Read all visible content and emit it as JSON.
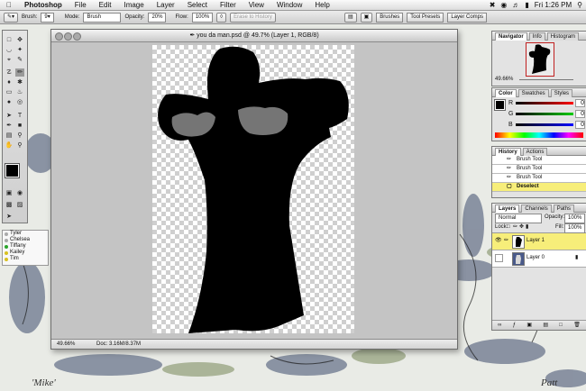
{
  "menubar": {
    "app_name": "Photoshop",
    "items": [
      "File",
      "Edit",
      "Image",
      "Layer",
      "Select",
      "Filter",
      "View",
      "Window",
      "Help"
    ],
    "clock": "Fri 1:26 PM"
  },
  "options_bar": {
    "brush_label": "Brush:",
    "brush_size": "9",
    "mode_label": "Mode:",
    "mode_value": "Brush",
    "opacity_label": "Opacity:",
    "opacity_value": "20%",
    "flow_label": "Flow:",
    "flow_value": "100%",
    "erase_history": "Erase to History",
    "tabs": [
      "Brushes",
      "Tool Presets",
      "Layer Comps"
    ]
  },
  "document": {
    "title": "you da man.psd @ 49.7% (Layer 1, RGB/8)",
    "zoom": "49.66%",
    "doc_info": "Doc: 3.16M/8.37M"
  },
  "navigator": {
    "tabs": [
      "Navigator",
      "Info",
      "Histogram"
    ],
    "zoom": "49.66%"
  },
  "color": {
    "tabs": [
      "Color",
      "Swatches",
      "Styles"
    ],
    "channels": [
      {
        "label": "R",
        "value": "0",
        "color": "#d01010"
      },
      {
        "label": "G",
        "value": "0",
        "color": "#10a010"
      },
      {
        "label": "B",
        "value": "0",
        "color": "#1020d0"
      }
    ]
  },
  "history": {
    "tabs": [
      "History",
      "Actions"
    ],
    "items": [
      "Brush Tool",
      "Brush Tool",
      "Brush Tool",
      "Deselect"
    ],
    "selected_index": 3
  },
  "layers": {
    "tabs": [
      "Layers",
      "Channels",
      "Paths"
    ],
    "blend_mode": "Normal",
    "opacity_label": "Opacity:",
    "opacity_value": "100%",
    "lock_label": "Lock:",
    "fill_label": "Fill:",
    "fill_value": "100%",
    "items": [
      {
        "name": "Layer 1"
      },
      {
        "name": "Layer 0"
      }
    ]
  },
  "buddies": [
    {
      "name": "Tyler",
      "color": "#aaaaaa"
    },
    {
      "name": "Chelsea",
      "color": "#aaaaaa"
    },
    {
      "name": "Tiffany",
      "color": "#2aa52a"
    },
    {
      "name": "Kailey",
      "color": "#d8c020"
    },
    {
      "name": "Tim",
      "color": "#d8c020"
    }
  ],
  "desktop_text": [
    "'Mike'",
    "Patt"
  ]
}
